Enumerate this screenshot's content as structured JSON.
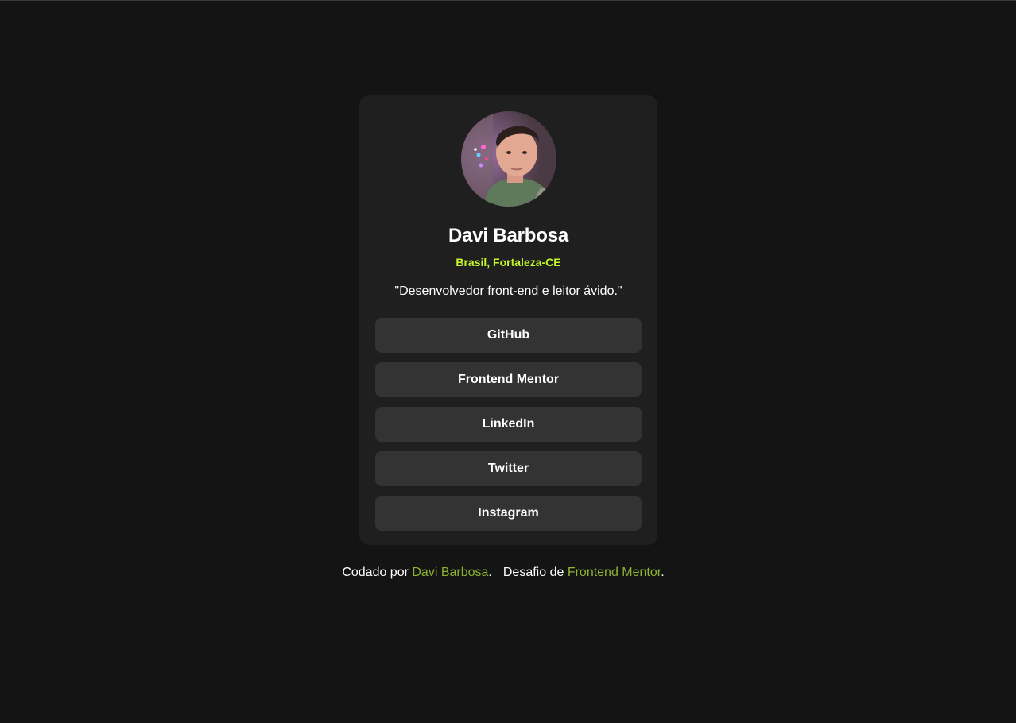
{
  "profile": {
    "name": "Davi Barbosa",
    "location": "Brasil, Fortaleza-CE",
    "bio": "\"Desenvolvedor front-end e leitor ávido.\"",
    "avatar": "profile-photo"
  },
  "links": [
    {
      "label": "GitHub"
    },
    {
      "label": "Frontend Mentor"
    },
    {
      "label": "LinkedIn"
    },
    {
      "label": "Twitter"
    },
    {
      "label": "Instagram"
    }
  ],
  "footer": {
    "coded_by_prefix": "Codado por ",
    "coded_by_link": "Davi Barbosa",
    "coded_by_suffix": ".",
    "challenge_prefix": "Desafio de ",
    "challenge_link": "Frontend Mentor",
    "challenge_suffix": "."
  },
  "colors": {
    "background": "#141414",
    "card": "#1f1f1f",
    "button": "#333333",
    "accent": "#c4f82a",
    "footer_link": "#8eb331"
  }
}
